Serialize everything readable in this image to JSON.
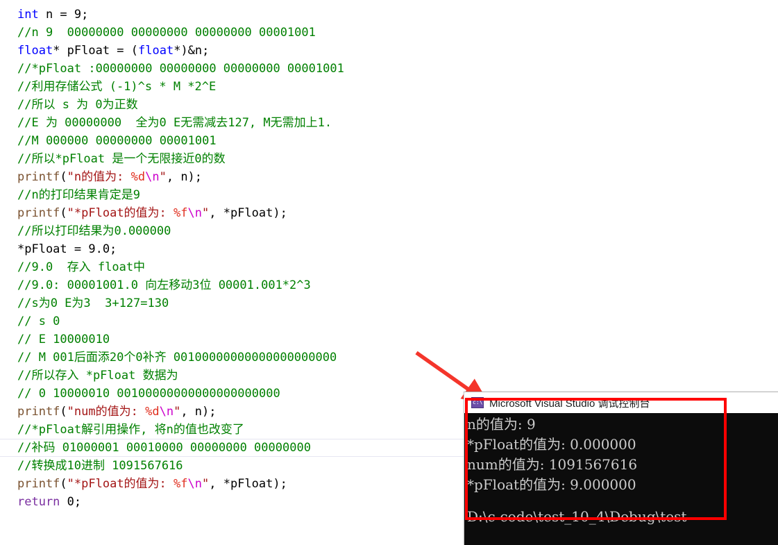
{
  "editor": {
    "name": "visual-studio-code-editor",
    "background": "#ffffff",
    "lines": [
      {
        "id": "l1",
        "text": "int n = 9;"
      },
      {
        "id": "l2",
        "text": "//n 9  00000000 00000000 00000000 00001001"
      },
      {
        "id": "l3",
        "text": "float* pFloat = (float*)&n;"
      },
      {
        "id": "l4",
        "text": "//*pFloat :00000000 00000000 00000000 00001001"
      },
      {
        "id": "l5",
        "text": "//利用存储公式 (-1)^s * M *2^E"
      },
      {
        "id": "l6",
        "text": "//所以 s 为 0为正数"
      },
      {
        "id": "l7",
        "text": "//E 为 00000000  全为0 E无需减去127, M无需加上1."
      },
      {
        "id": "l8",
        "text": "//M 000000 00000000 00001001"
      },
      {
        "id": "l9",
        "text": "//所以*pFloat 是一个无限接近0的数"
      },
      {
        "id": "l10",
        "text": "printf(\"n的值为: %d\\n\", n);"
      },
      {
        "id": "l11",
        "text": "//n的打印结果肯定是9"
      },
      {
        "id": "l12",
        "text": "printf(\"*pFloat的值为: %f\\n\", *pFloat);"
      },
      {
        "id": "l13",
        "text": "//所以打印结果为0.000000"
      },
      {
        "id": "l14",
        "text": "*pFloat = 9.0;"
      },
      {
        "id": "l15",
        "text": "//9.0  存入 float中"
      },
      {
        "id": "l16",
        "text": "//9.0: 00001001.0 向左移动3位 00001.001*2^3"
      },
      {
        "id": "l17",
        "text": "//s为0 E为3  3+127=130"
      },
      {
        "id": "l18",
        "text": "// s 0"
      },
      {
        "id": "l19",
        "text": "// E 10000010"
      },
      {
        "id": "l20",
        "text": "// M 001后面添20个0补齐 00100000000000000000000"
      },
      {
        "id": "l21",
        "text": "//所以存入 *pFloat 数据为"
      },
      {
        "id": "l22",
        "text": "// 0 10000010 00100000000000000000000"
      },
      {
        "id": "l23",
        "text": "printf(\"num的值为: %d\\n\", n);"
      },
      {
        "id": "l24",
        "text": "//*pFloat解引用操作, 将n的值也改变了"
      },
      {
        "id": "l25",
        "text": "//补码 01000001 00010000 00000000 00000000"
      },
      {
        "id": "l26",
        "text": "//转换成10进制 1091567616"
      },
      {
        "id": "l27",
        "text": "printf(\"*pFloat的值为: %f\\n\", *pFloat);"
      },
      {
        "id": "l28",
        "text": "return 0;"
      }
    ],
    "current_line_id": "l25",
    "syntax_colors": {
      "keyword": "#0000ff",
      "keyword_control": "#7a2fa0",
      "comment": "#008000",
      "string": "#a31515",
      "escape": "#cc00cc",
      "format_specifier": "#e03020",
      "function": "#7a5230",
      "plain": "#000000"
    },
    "tokens": {
      "l1": [
        {
          "t": "int",
          "c": "kw"
        },
        {
          "t": " n = 9;",
          "c": "punct"
        }
      ],
      "l2": [
        {
          "t": "//n 9  00000000 00000000 00000000 00001001",
          "c": "cmt"
        }
      ],
      "l3": [
        {
          "t": "float",
          "c": "kw"
        },
        {
          "t": "* pFloat = (",
          "c": "punct"
        },
        {
          "t": "float",
          "c": "kw"
        },
        {
          "t": "*)&n;",
          "c": "punct"
        }
      ],
      "l4": [
        {
          "t": "//*pFloat :00000000 00000000 00000000 00001001",
          "c": "cmt"
        }
      ],
      "l5": [
        {
          "t": "//利用存储公式 (-1)^s * M *2^E",
          "c": "cmt"
        }
      ],
      "l6": [
        {
          "t": "//所以 s 为 0为正数",
          "c": "cmt"
        }
      ],
      "l7": [
        {
          "t": "//E 为 00000000  全为0 E无需减去127, M无需加上1.",
          "c": "cmt"
        }
      ],
      "l8": [
        {
          "t": "//M 000000 00000000 00001001",
          "c": "cmt"
        }
      ],
      "l9": [
        {
          "t": "//所以*pFloat 是一个无限接近0的数",
          "c": "cmt"
        }
      ],
      "l10": [
        {
          "t": "printf",
          "c": "fn"
        },
        {
          "t": "(",
          "c": "punct"
        },
        {
          "t": "\"n的值为: ",
          "c": "str"
        },
        {
          "t": "%d",
          "c": "fmt"
        },
        {
          "t": "\\n",
          "c": "esc"
        },
        {
          "t": "\"",
          "c": "str"
        },
        {
          "t": ", n);",
          "c": "punct"
        }
      ],
      "l11": [
        {
          "t": "//n的打印结果肯定是9",
          "c": "cmt"
        }
      ],
      "l12": [
        {
          "t": "printf",
          "c": "fn"
        },
        {
          "t": "(",
          "c": "punct"
        },
        {
          "t": "\"*pFloat的值为: ",
          "c": "str"
        },
        {
          "t": "%f",
          "c": "fmt"
        },
        {
          "t": "\\n",
          "c": "esc"
        },
        {
          "t": "\"",
          "c": "str"
        },
        {
          "t": ", *pFloat);",
          "c": "punct"
        }
      ],
      "l13": [
        {
          "t": "//所以打印结果为0.000000",
          "c": "cmt"
        }
      ],
      "l14": [
        {
          "t": "*pFloat = 9.0;",
          "c": "punct"
        }
      ],
      "l15": [
        {
          "t": "//9.0  存入 float中",
          "c": "cmt"
        }
      ],
      "l16": [
        {
          "t": "//9.0: 00001001.0 向左移动3位 00001.001*2^3",
          "c": "cmt"
        }
      ],
      "l17": [
        {
          "t": "//s为0 E为3  3+127=130",
          "c": "cmt"
        }
      ],
      "l18": [
        {
          "t": "// s 0",
          "c": "cmt"
        }
      ],
      "l19": [
        {
          "t": "// E 10000010",
          "c": "cmt"
        }
      ],
      "l20": [
        {
          "t": "// M 001后面添20个0补齐 00100000000000000000000",
          "c": "cmt"
        }
      ],
      "l21": [
        {
          "t": "//所以存入 *pFloat 数据为",
          "c": "cmt"
        }
      ],
      "l22": [
        {
          "t": "// 0 10000010 00100000000000000000000",
          "c": "cmt"
        }
      ],
      "l23": [
        {
          "t": "printf",
          "c": "fn"
        },
        {
          "t": "(",
          "c": "punct"
        },
        {
          "t": "\"num的值为: ",
          "c": "str"
        },
        {
          "t": "%d",
          "c": "fmt"
        },
        {
          "t": "\\n",
          "c": "esc"
        },
        {
          "t": "\"",
          "c": "str"
        },
        {
          "t": ", n);",
          "c": "punct"
        }
      ],
      "l24": [
        {
          "t": "//*pFloat解引用操作, 将n的值也改变了",
          "c": "cmt"
        }
      ],
      "l25": [
        {
          "t": "//补码 01000001 00010000 00000000 00000000",
          "c": "cmt"
        }
      ],
      "l26": [
        {
          "t": "//转换成10进制 1091567616",
          "c": "cmt"
        }
      ],
      "l27": [
        {
          "t": "printf",
          "c": "fn"
        },
        {
          "t": "(",
          "c": "punct"
        },
        {
          "t": "\"*pFloat的值为: ",
          "c": "str"
        },
        {
          "t": "%f",
          "c": "fmt"
        },
        {
          "t": "\\n",
          "c": "esc"
        },
        {
          "t": "\"",
          "c": "str"
        },
        {
          "t": ", *pFloat);",
          "c": "punct"
        }
      ],
      "l28": [
        {
          "t": "return",
          "c": "kwv"
        },
        {
          "t": " 0;",
          "c": "punct"
        }
      ]
    }
  },
  "console_window": {
    "icon": "console-app-icon",
    "title": "Microsoft Visual Studio 调试控制台",
    "background": "#0c0c0c",
    "text_color": "#cccccc",
    "output_lines": [
      "n的值为: 9",
      "*pFloat的值为: 0.000000",
      "num的值为: 1091567616",
      "*pFloat的值为: 9.000000"
    ],
    "path_line": "D:\\c-code\\test_10_4\\Debug\\test"
  },
  "annotations": {
    "arrow_color": "#ff2020",
    "box_color": "#ff0000",
    "arrow_name": "red-pointer-arrow",
    "box_name": "red-highlight-box"
  }
}
